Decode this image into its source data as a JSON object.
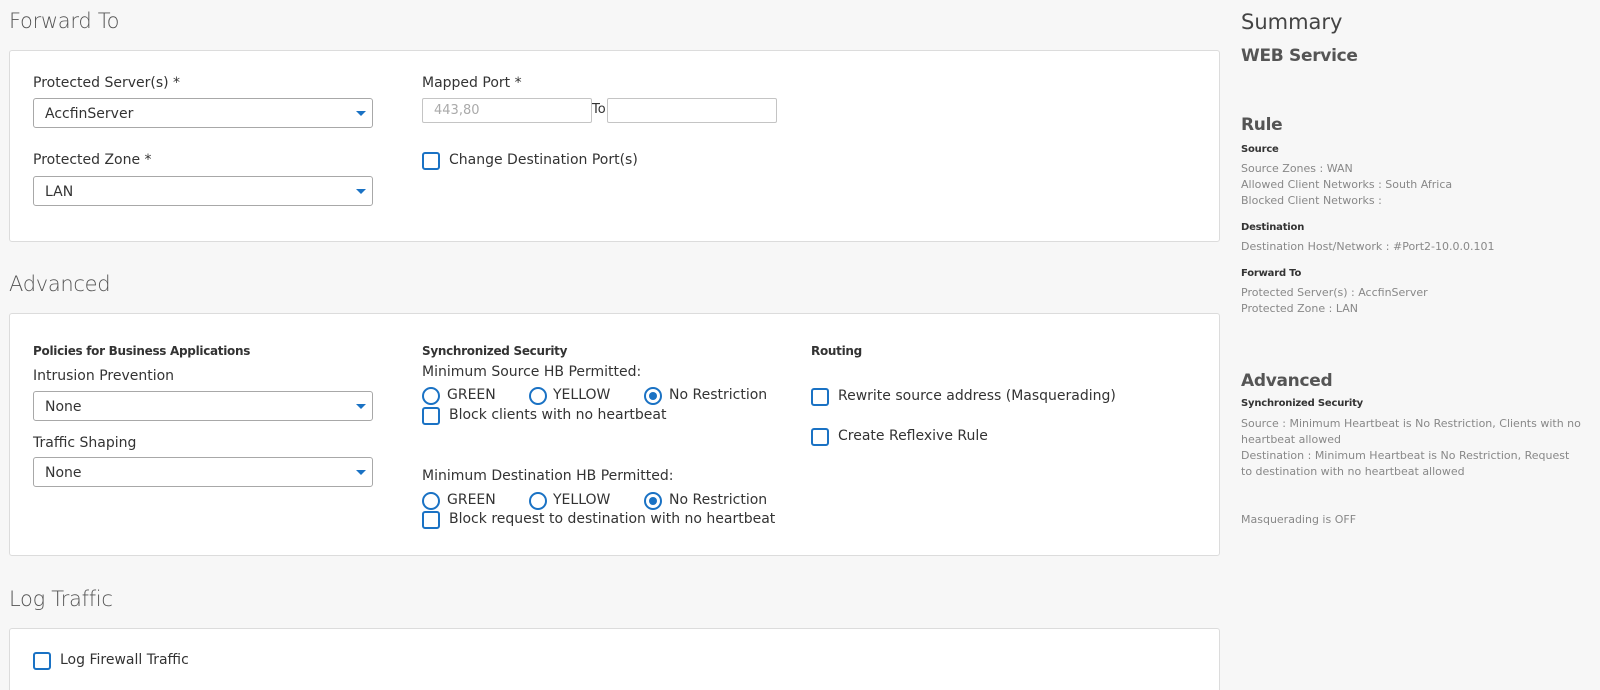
{
  "forward_to": {
    "title": "Forward To",
    "protected_servers_label": "Protected Server(s) *",
    "protected_servers_value": "AccfinServer",
    "protected_zone_label": "Protected Zone *",
    "protected_zone_value": "LAN",
    "mapped_port_label": "Mapped Port *",
    "mapped_port_placeholder": "443,80",
    "to_label": "To",
    "to_value": "",
    "change_dest_label": "Change Destination Port(s)"
  },
  "advanced": {
    "title": "Advanced",
    "policies_heading": "Policies for Business Applications",
    "intrusion_label": "Intrusion Prevention",
    "intrusion_value": "None",
    "shaping_label": "Traffic Shaping",
    "shaping_value": "None",
    "sync_heading": "Synchronized Security",
    "min_source_label": "Minimum Source HB Permitted:",
    "min_dest_label": "Minimum Destination HB Permitted:",
    "hb_options": [
      "GREEN",
      "YELLOW",
      "No Restriction"
    ],
    "hb_selected_index": 2,
    "block_clients_label": "Block clients with no heartbeat",
    "block_request_label": "Block request to destination with no heartbeat",
    "routing_heading": "Routing",
    "rewrite_label": "Rewrite source address (Masquerading)",
    "reflexive_label": "Create Reflexive Rule"
  },
  "log": {
    "title": "Log Traffic",
    "log_firewall_label": "Log Firewall Traffic"
  },
  "summary": {
    "title": "Summary",
    "subtitle": "WEB Service",
    "rule_heading": "Rule",
    "source_heading": "Source",
    "source_lines": [
      "Source Zones : WAN",
      "Allowed Client Networks : South Africa",
      "Blocked Client Networks :"
    ],
    "destination_heading": "Destination",
    "destination_lines": [
      "Destination Host/Network : #Port2-10.0.0.101"
    ],
    "forward_heading": "Forward To",
    "forward_lines": [
      "Protected Server(s) : AccfinServer",
      "Protected Zone : LAN"
    ],
    "advanced_heading": "Advanced",
    "sync_heading": "Synchronized Security",
    "sync_lines": [
      "Source : Minimum Heartbeat is No Restriction, Clients with no",
      "heartbeat allowed",
      "Destination : Minimum Heartbeat is No Restriction, Request",
      "to destination with no heartbeat allowed"
    ],
    "masq_line": "Masquerading is OFF"
  },
  "colors": {
    "accent": "#1a72c4",
    "card_border": "#dcdcdc",
    "page_bg": "#f7f7f7"
  }
}
